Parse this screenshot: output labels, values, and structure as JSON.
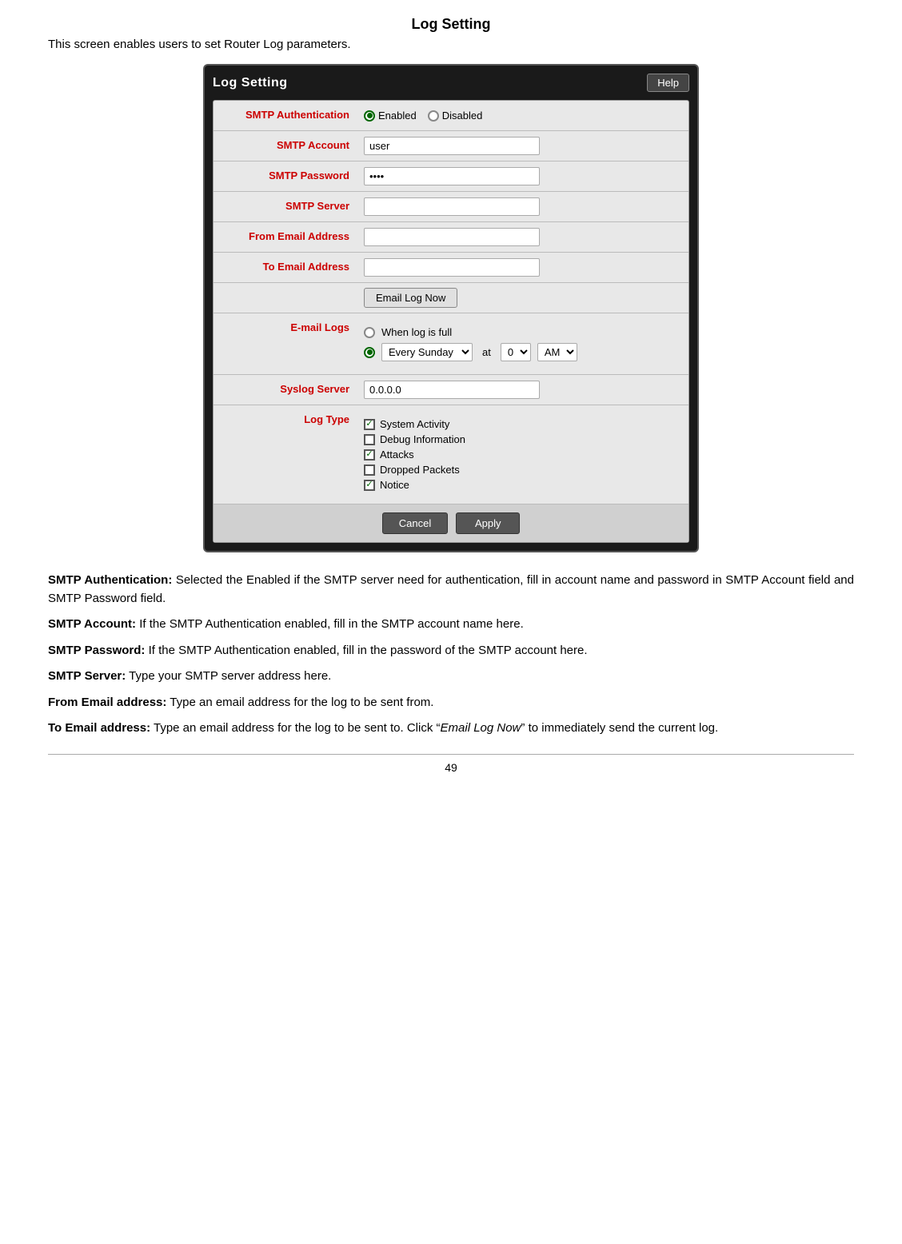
{
  "page": {
    "title": "Log Setting",
    "intro": "This screen enables users to set Router Log parameters.",
    "footer_page": "49"
  },
  "panel": {
    "title": "Log Setting",
    "help_button": "Help",
    "rows": {
      "smtp_auth_label": "SMTP Authentication",
      "smtp_auth_enabled": "Enabled",
      "smtp_auth_disabled": "Disabled",
      "smtp_account_label": "SMTP Account",
      "smtp_account_value": "user",
      "smtp_password_label": "SMTP Password",
      "smtp_password_value": "••••",
      "smtp_server_label": "SMTP Server",
      "smtp_server_value": "",
      "from_email_label": "From Email Address",
      "from_email_value": "",
      "to_email_label": "To Email Address",
      "to_email_value": "",
      "email_log_now_btn": "Email Log Now",
      "email_logs_label": "E-mail Logs",
      "when_log_full": "When log is full",
      "every_sunday": "Every Sunday",
      "at_label": "at",
      "hour_value": "0",
      "ampm_value": "AM",
      "syslog_server_label": "Syslog Server",
      "syslog_server_value": "0.0.0.0",
      "log_type_label": "Log Type",
      "log_type_items": [
        {
          "label": "System Activity",
          "checked": true
        },
        {
          "label": "Debug Information",
          "checked": false
        },
        {
          "label": "Attacks",
          "checked": true
        },
        {
          "label": "Dropped Packets",
          "checked": false
        },
        {
          "label": "Notice",
          "checked": true
        }
      ]
    },
    "cancel_btn": "Cancel",
    "apply_btn": "Apply"
  },
  "descriptions": [
    {
      "bold": "SMTP Authentication:",
      "text": "  Selected the Enabled if the SMTP server need for authentication, fill in account name and password in SMTP Account field and SMTP Password field."
    },
    {
      "bold": "SMTP Account:",
      "text": " If the SMTP Authentication enabled, fill in the SMTP account name here."
    },
    {
      "bold": "SMTP Password:",
      "text": " If the SMTP Authentication enabled, fill in the password of the SMTP account here."
    },
    {
      "bold": "SMTP Server:",
      "text": " Type your SMTP server address here."
    },
    {
      "bold": "From Email address:",
      "text": " Type an email address for the log to be sent from."
    },
    {
      "bold": "To Email address:",
      "text": " Type an email address for the log to be sent to. Click “Email Log Now” to immediately send the current log."
    }
  ]
}
